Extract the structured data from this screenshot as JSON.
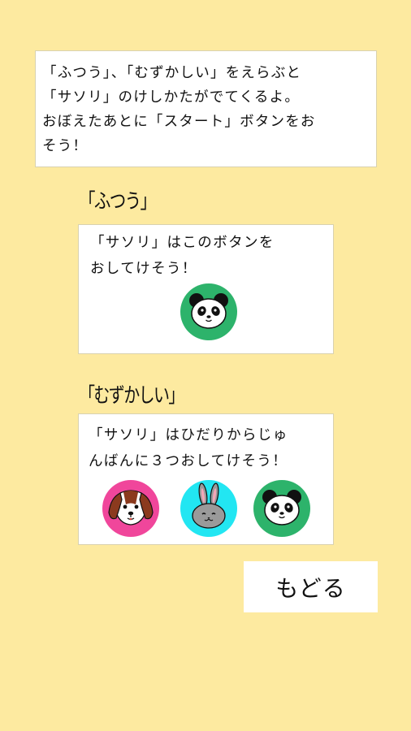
{
  "intro": {
    "lines": [
      "「ふつう」、「むずかしい」をえらぶと",
      "「サソリ」のけしかたがでてくるよ。",
      "おぼえたあとに「スタート」ボタンをお",
      "そう！"
    ]
  },
  "normal": {
    "heading": "「ふつう」",
    "lines": [
      "「サソリ」はこのボタンを",
      "おしてけそう！"
    ],
    "buttons": [
      {
        "icon": "panda-icon",
        "color": "#2db36b"
      }
    ]
  },
  "hard": {
    "heading": "「むずかしい」",
    "lines": [
      "「サソリ」はひだりからじゅ",
      "んばんに３つおしてけそう！"
    ],
    "buttons": [
      {
        "icon": "dog-icon",
        "color": "#f0469b"
      },
      {
        "icon": "rabbit-icon",
        "color": "#22e6f2"
      },
      {
        "icon": "panda-icon",
        "color": "#2db36b"
      }
    ]
  },
  "back_button": {
    "label": "もどる"
  },
  "colors": {
    "background": "#fdeaa0",
    "panel": "#ffffff"
  }
}
